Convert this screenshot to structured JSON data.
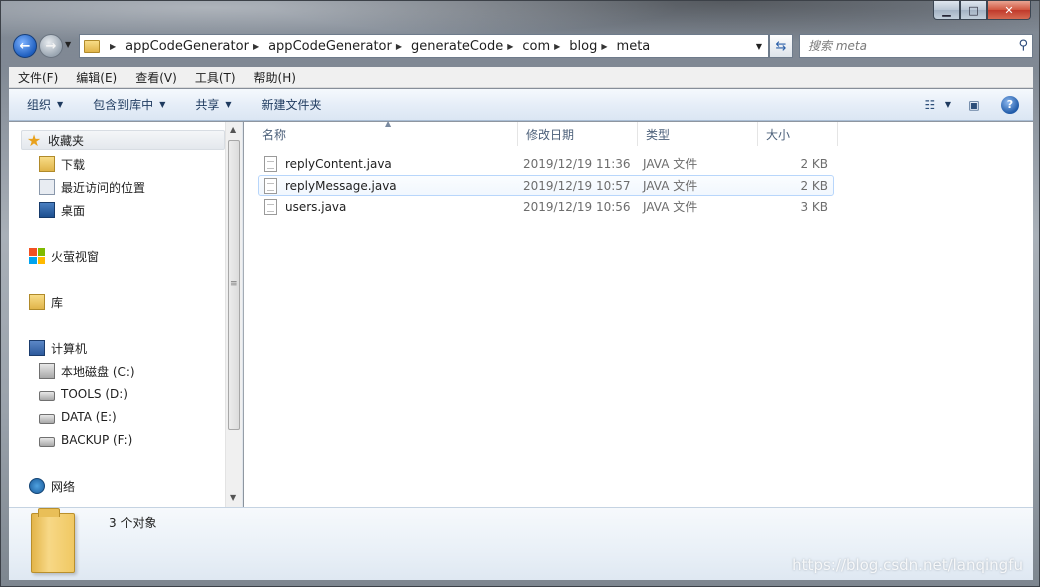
{
  "window": {
    "minimize_glyph": "▁",
    "maximize_glyph": "□",
    "close_glyph": "✕"
  },
  "nav": {
    "back_glyph": "←",
    "forward_glyph": "→",
    "breadcrumb": [
      "appCodeGenerator",
      "appCodeGenerator",
      "generateCode",
      "com",
      "blog",
      "meta"
    ],
    "search_placeholder": "搜索 meta"
  },
  "menu": [
    "文件(F)",
    "编辑(E)",
    "查看(V)",
    "工具(T)",
    "帮助(H)"
  ],
  "commands": {
    "organize": "组织",
    "include_library": "包含到库中",
    "share": "共享",
    "new_folder": "新建文件夹"
  },
  "navpane": {
    "favorites": "收藏夹",
    "downloads": "下载",
    "recent": "最近访问的位置",
    "desktop": "桌面",
    "firefly": "火萤视窗",
    "library": "库",
    "computer": "计算机",
    "drive_c": "本地磁盘 (C:)",
    "drive_d": "TOOLS (D:)",
    "drive_e": "DATA (E:)",
    "drive_f": "BACKUP (F:)",
    "network": "网络"
  },
  "columns": {
    "name": "名称",
    "modified": "修改日期",
    "type": "类型",
    "size": "大小"
  },
  "files": [
    {
      "name": "replyContent.java",
      "modified": "2019/12/19 11:36",
      "type": "JAVA 文件",
      "size": "2 KB"
    },
    {
      "name": "replyMessage.java",
      "modified": "2019/12/19 10:57",
      "type": "JAVA 文件",
      "size": "2 KB"
    },
    {
      "name": "users.java",
      "modified": "2019/12/19 10:56",
      "type": "JAVA 文件",
      "size": "3 KB"
    }
  ],
  "details": {
    "count": "3 个对象"
  },
  "watermark": "https://blog.csdn.net/lanqingfu"
}
